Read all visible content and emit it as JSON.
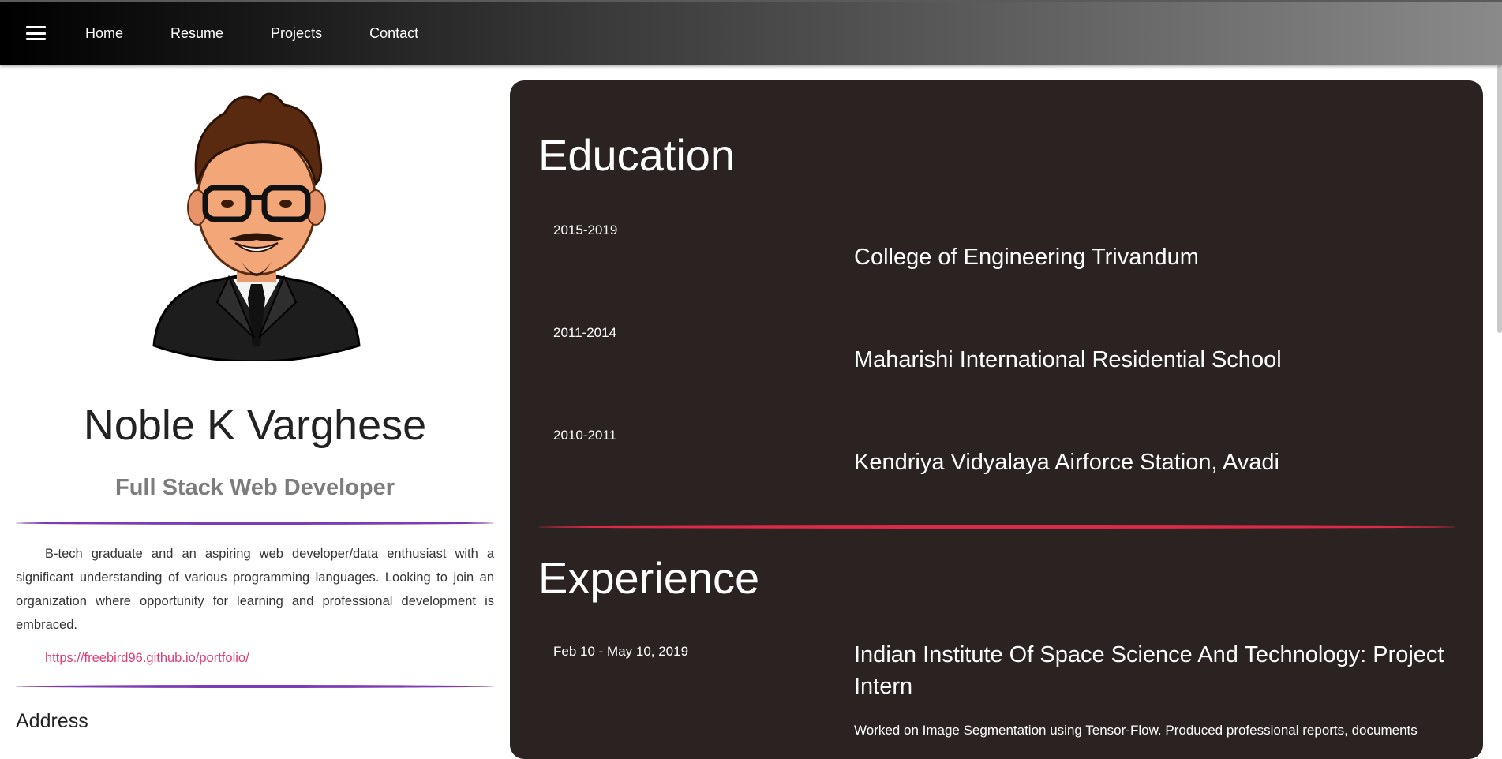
{
  "nav": {
    "menu_icon": "hamburger-menu-icon",
    "links": [
      "Home",
      "Resume",
      "Projects",
      "Contact"
    ]
  },
  "profile": {
    "avatar": "cartoon-avatar-portrait",
    "name": "Noble K Varghese",
    "role": "Full Stack Web Developer",
    "bio": "B-tech graduate and an aspiring web developer/data enthusiast with a significant understanding of various programming languages. Looking to join an organization where opportunity for learning and professional development is embraced.",
    "portfolio_url": "https://freebird96.github.io/portfolio/",
    "address_heading": "Address"
  },
  "education": {
    "title": "Education",
    "items": [
      {
        "years": "2015-2019",
        "institution": "College of Engineering Trivandum"
      },
      {
        "years": "2011-2014",
        "institution": "Maharishi International Residential School"
      },
      {
        "years": "2010-2011",
        "institution": "Kendriya Vidyalaya Airforce Station, Avadi"
      }
    ]
  },
  "experience": {
    "title": "Experience",
    "items": [
      {
        "dates": "Feb 10 - May 10, 2019",
        "role": "Indian Institute Of Space Science And Technology: Project Intern",
        "description": "Worked on Image Segmentation using Tensor-Flow. Produced professional reports, documents"
      }
    ]
  },
  "colors": {
    "panel_bg": "#2a2321",
    "accent_purple": "#7d3cb6",
    "accent_red": "#dc2a48",
    "link_pink": "#e33c78"
  }
}
